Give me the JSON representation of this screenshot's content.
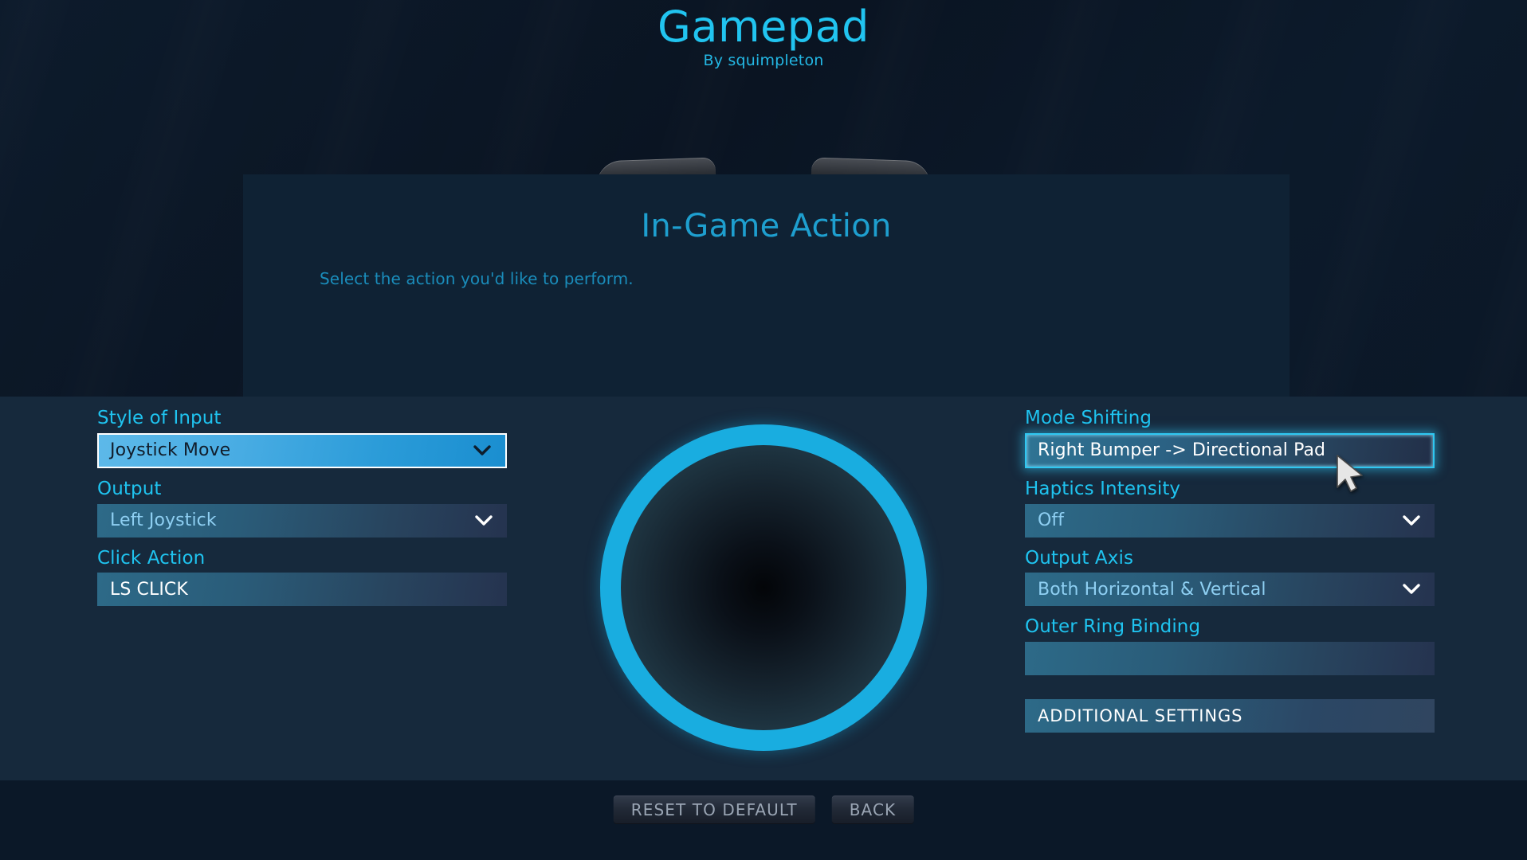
{
  "header": {
    "title": "Gamepad",
    "subtitle": "By squimpleton"
  },
  "panel": {
    "title": "In-Game Action",
    "subtitle": "Select the action you'd like to perform."
  },
  "left_column": {
    "style_of_input": {
      "label": "Style of Input",
      "value": "Joystick Move"
    },
    "output": {
      "label": "Output",
      "value": "Left Joystick"
    },
    "click_action": {
      "label": "Click Action",
      "value": "LS CLICK"
    }
  },
  "right_column": {
    "mode_shifting": {
      "label": "Mode Shifting",
      "value": "Right Bumper -> Directional Pad"
    },
    "haptics_intensity": {
      "label": "Haptics Intensity",
      "value": "Off"
    },
    "output_axis": {
      "label": "Output Axis",
      "value": "Both Horizontal & Vertical"
    },
    "outer_ring_binding": {
      "label": "Outer Ring Binding",
      "value": ""
    },
    "additional_settings": {
      "label": "ADDITIONAL SETTINGS"
    }
  },
  "footer": {
    "reset_label": "RESET TO DEFAULT",
    "back_label": "BACK"
  },
  "colors": {
    "accent_cyan": "#1fc3ef",
    "title_cyan": "#21c4f0",
    "panel_title": "#1e9fcf",
    "joystick_ring": "#19ade0",
    "background": "#0b1726",
    "panel_bg": "#0f2234",
    "main_bg": "#16293c",
    "footer_bg": "#0b1828",
    "selected_field": "#48ace3",
    "glow_border": "#2fc7f1"
  },
  "icons": {
    "chevron_down": "chevron-down-icon",
    "cursor": "mouse-cursor-icon"
  }
}
